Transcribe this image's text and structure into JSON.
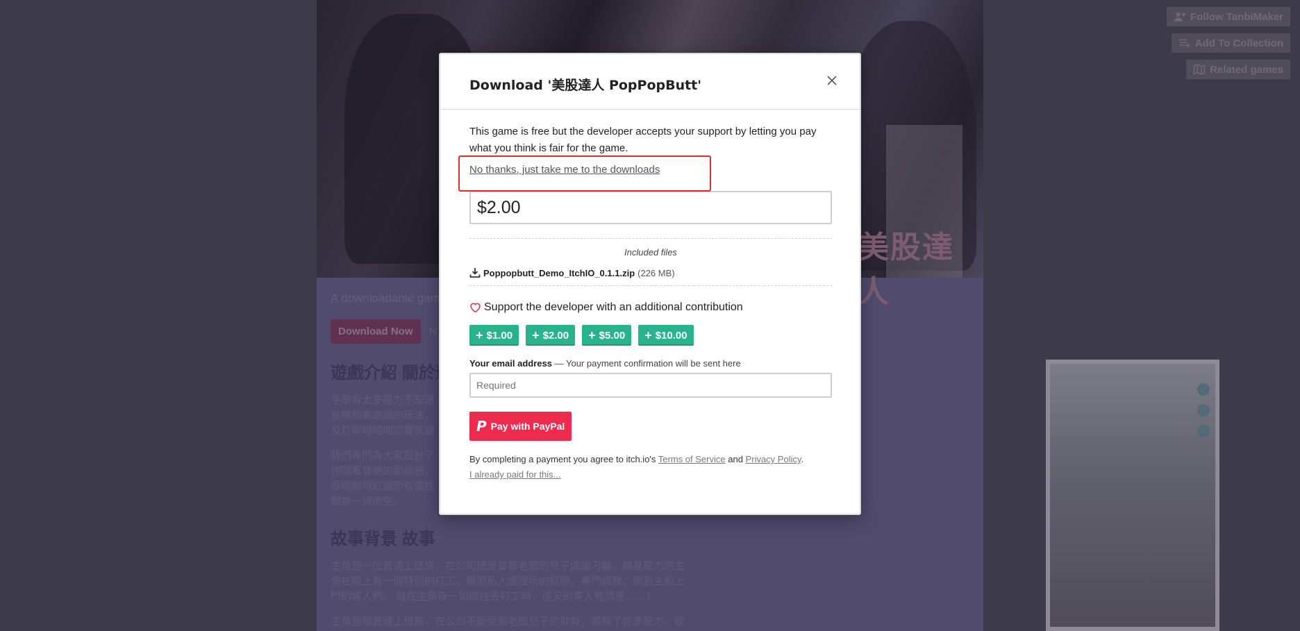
{
  "header_actions": {
    "follow": "Follow TanbiMaker",
    "collection": "Add To Collection",
    "related": "Related games"
  },
  "background": {
    "banner_logo": "美股達人",
    "tagline": "A downloadable gam",
    "download_now": "Download Now",
    "name_your_price_partial": "N",
    "heading_1": "遊戲介紹 關於遊",
    "para_1": "平常有太多壓力不知道\n音樂節奏遊戲的玩法，\n及打擊時啪啪的響亮聲",
    "para_2": "我們專門為大家設計了\n伴隨著音樂的節奏感，\n股時變得紅潤而有彈性\n都被一掃而空。",
    "heading_2": "故事背景 故事",
    "para_3": "主角是一位普通上班族，在公司總是會被老闆的兒子處處刁難，積身壓力的主\n角在晚上有一個特別的打工，擊閒私人護理所的紅牌，專門調教、懲罰主動上\n門的客人們。 就在主角夜一如既往去打工時，這天的客人竟然是……！",
    "para_4": "主角是個普通上班族，在公司不斷受到老闆兒子的欺負，累積了許多壓力。晚"
  },
  "modal": {
    "title": "Download '美股達人 PopPopButt'",
    "intro": "This game is free but the developer accepts your support by letting you pay what you think is fair for the game.",
    "no_thanks": "No thanks, just take me to the downloads",
    "price_value": "$2.00",
    "included_files_label": "Included files",
    "file_name": "Poppopbutt_Demo_ItchIO_0.1.1.zip",
    "file_size": "(226 MB)",
    "support_text": "Support the developer with an additional contribution",
    "amounts": [
      "$1.00",
      "$2.00",
      "$5.00",
      "$10.00"
    ],
    "email_label": "Your email address",
    "email_hint": "— Your payment confirmation will be sent here",
    "email_placeholder": "Required",
    "paypal_button": "Pay with PayPal",
    "legal_prefix": "By completing a payment you agree to itch.io's",
    "terms": "Terms of Service",
    "and": "and",
    "privacy": "Privacy Policy",
    "period": ".",
    "already_paid": "I already paid for this..."
  },
  "colors": {
    "accent_green": "#28b38d",
    "paypal_red": "#ee2a4e",
    "highlight_red": "#e12b2b"
  }
}
